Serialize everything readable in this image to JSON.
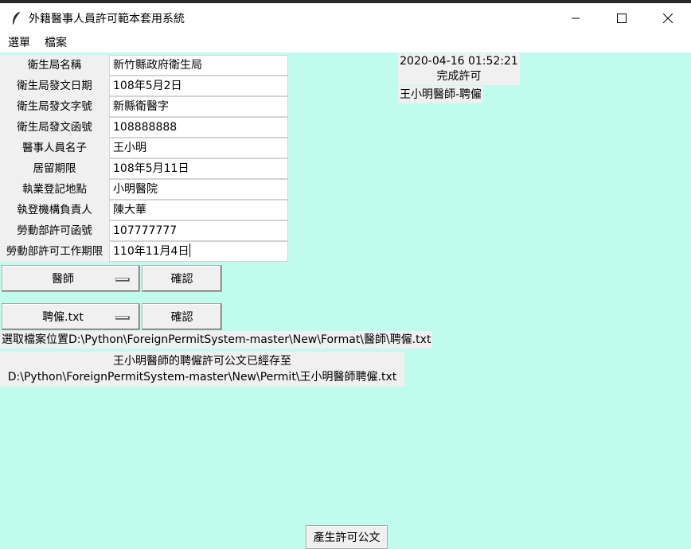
{
  "window": {
    "title": "外籍醫事人員許可範本套用系統",
    "minimize_glyph": "—",
    "maximize_glyph": "☐",
    "close_glyph": "✕",
    "app_icon": "feather-icon"
  },
  "menu": [
    "選單",
    "檔案"
  ],
  "form": {
    "labels": [
      "衛生局名稱",
      "衛生局發文日期",
      "衛生局發文字號",
      "衛生局發文函號",
      "醫事人員名子",
      "居留期限",
      "執業登記地點",
      "執登機構負責人",
      "勞動部許可函號",
      "勞動部許可工作期限"
    ],
    "values": [
      "新竹縣政府衛生局",
      "108年5月2日",
      "新縣衛醫字",
      "108888888",
      "王小明",
      "108年5月11日",
      "小明醫院",
      "陳大華",
      "107777777",
      "110年11月4日"
    ]
  },
  "status": {
    "datetime": "2020-04-16 01:52:21",
    "done": "完成許可",
    "doc_name": "王小明醫師-聘僱"
  },
  "selectors": {
    "profession": "醫師",
    "confirm1": "確認",
    "template": "聘僱.txt",
    "confirm2": "確認"
  },
  "messages": {
    "file_location": "選取檔案位置D:\\Python\\ForeignPermitSystem-master\\New\\Format\\醫師\\聘僱.txt",
    "saved_line1": "王小明醫師的聘僱許可公文已經存至",
    "saved_line2": "D:\\Python\\ForeignPermitSystem-master\\New\\Permit\\王小明醫師聘僱.txt"
  },
  "generate_button": "產生許可公文"
}
